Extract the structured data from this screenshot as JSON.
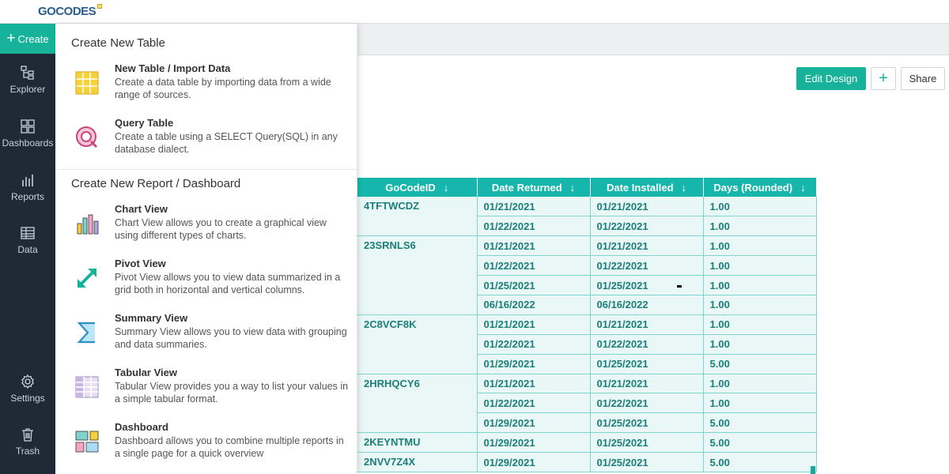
{
  "app": {
    "logo": "GOCODES"
  },
  "sidebar": {
    "create_label": "Create",
    "items": [
      {
        "label": "Explorer",
        "icon": "explorer-icon"
      },
      {
        "label": "Dashboards",
        "icon": "dashboards-icon"
      },
      {
        "label": "Reports",
        "icon": "reports-icon"
      },
      {
        "label": "Data",
        "icon": "data-icon"
      },
      {
        "label": "Settings",
        "icon": "gear-icon"
      },
      {
        "label": "Trash",
        "icon": "trash-icon"
      }
    ]
  },
  "menu": {
    "section1": "Create New Table",
    "section2": "Create New Report / Dashboard",
    "items": [
      {
        "title": "New Table / Import Data",
        "desc": "Create a data table by importing data from a wide range of sources.",
        "icon": "table-grid-icon"
      },
      {
        "title": "Query Table",
        "desc": "Create a table using a SELECT Query(SQL) in any database dialect.",
        "icon": "query-icon"
      },
      {
        "title": "Chart View",
        "desc": "Chart View allows you to create a graphical view using different types of charts.",
        "icon": "bar-chart-icon"
      },
      {
        "title": "Pivot View",
        "desc": "Pivot View allows you to view data summarized in a grid both in horizontal and vertical columns.",
        "icon": "pivot-arrow-icon"
      },
      {
        "title": "Summary View",
        "desc": "Summary View allows you to view data with grouping and data summaries.",
        "icon": "sigma-icon"
      },
      {
        "title": "Tabular View",
        "desc": "Tabular View provides you a way to list your values in a simple tabular format.",
        "icon": "tabular-icon"
      },
      {
        "title": "Dashboard",
        "desc": "Dashboard allows you to combine multiple reports in a single page for a quick overview",
        "icon": "dashboard-tiles-icon"
      }
    ]
  },
  "toolbar": {
    "edit_design": "Edit Design",
    "add": "+",
    "share": "Share"
  },
  "table": {
    "sort_icon": "↓",
    "columns": [
      "GoCodeID",
      "Date Returned",
      "Date Installed",
      "Days (Rounded)"
    ],
    "groups": [
      {
        "id": "4TFTWCDZ",
        "rows": [
          [
            "01/21/2021",
            "01/21/2021",
            "1.00"
          ],
          [
            "01/22/2021",
            "01/22/2021",
            "1.00"
          ]
        ]
      },
      {
        "id": "23SRNLS6",
        "rows": [
          [
            "01/21/2021",
            "01/21/2021",
            "1.00"
          ],
          [
            "01/22/2021",
            "01/22/2021",
            "1.00"
          ],
          [
            "01/25/2021",
            "01/25/2021",
            "1.00"
          ],
          [
            "06/16/2022",
            "06/16/2022",
            "1.00"
          ]
        ]
      },
      {
        "id": "2C8VCF8K",
        "rows": [
          [
            "01/21/2021",
            "01/21/2021",
            "1.00"
          ],
          [
            "01/22/2021",
            "01/22/2021",
            "1.00"
          ],
          [
            "01/29/2021",
            "01/25/2021",
            "5.00"
          ]
        ]
      },
      {
        "id": "2HRHQCY6",
        "rows": [
          [
            "01/21/2021",
            "01/21/2021",
            "1.00"
          ],
          [
            "01/22/2021",
            "01/22/2021",
            "1.00"
          ],
          [
            "01/29/2021",
            "01/25/2021",
            "5.00"
          ]
        ]
      },
      {
        "id": "2KEYNTMU",
        "rows": [
          [
            "01/29/2021",
            "01/25/2021",
            "5.00"
          ]
        ]
      },
      {
        "id": "2NVV7Z4X",
        "rows": [
          [
            "01/29/2021",
            "01/25/2021",
            "5.00"
          ]
        ]
      }
    ]
  },
  "colors": {
    "accent": "#17b29a",
    "header": "#17b6ad",
    "sidebar": "#1f2a36"
  }
}
